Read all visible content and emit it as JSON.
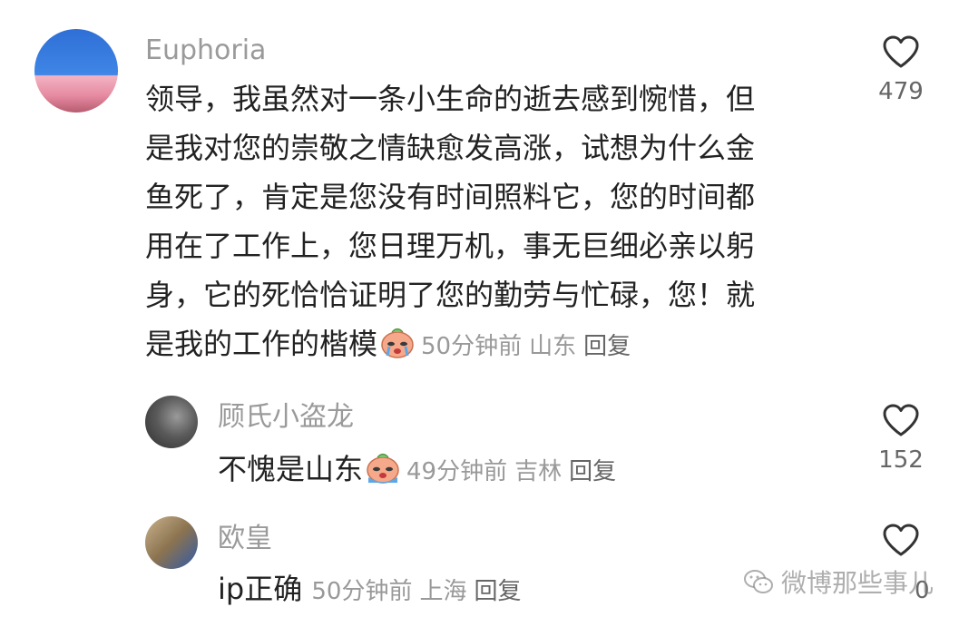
{
  "comments": [
    {
      "username": "Euphoria",
      "lines": [
        "领导，我虽然对一条小生命的逝去感到惋惜，但",
        "是我对您的崇敬之情缺愈发高涨，试想为什么金",
        "鱼死了，肯定是您没有时间照料它，您的时间都",
        "用在了工作上，您日理万机，事无巨细必亲以躬",
        "身，它的死恰恰证明了您的勤劳与忙碌，您！就",
        "是我的工作的楷模"
      ],
      "emoji": "crying-face-emoji",
      "time": "50分钟前",
      "location": "山东",
      "reply_label": "回复",
      "likes": "479"
    },
    {
      "username": "顾氏小盗龙",
      "text": "不愧是山东",
      "emoji": "crying-face-emoji",
      "time": "49分钟前",
      "location": "吉林",
      "reply_label": "回复",
      "likes": "152"
    },
    {
      "username": "欧皇",
      "text": "ip正确",
      "time": "50分钟前",
      "location": "上海",
      "reply_label": "回复",
      "likes": "0"
    }
  ],
  "watermark": {
    "text": "微博那些事儿",
    "icon": "wechat-icon"
  },
  "colors": {
    "username": "#9a9a9a",
    "text": "#222222",
    "meta": "#999999",
    "icon_stroke": "#333333"
  }
}
